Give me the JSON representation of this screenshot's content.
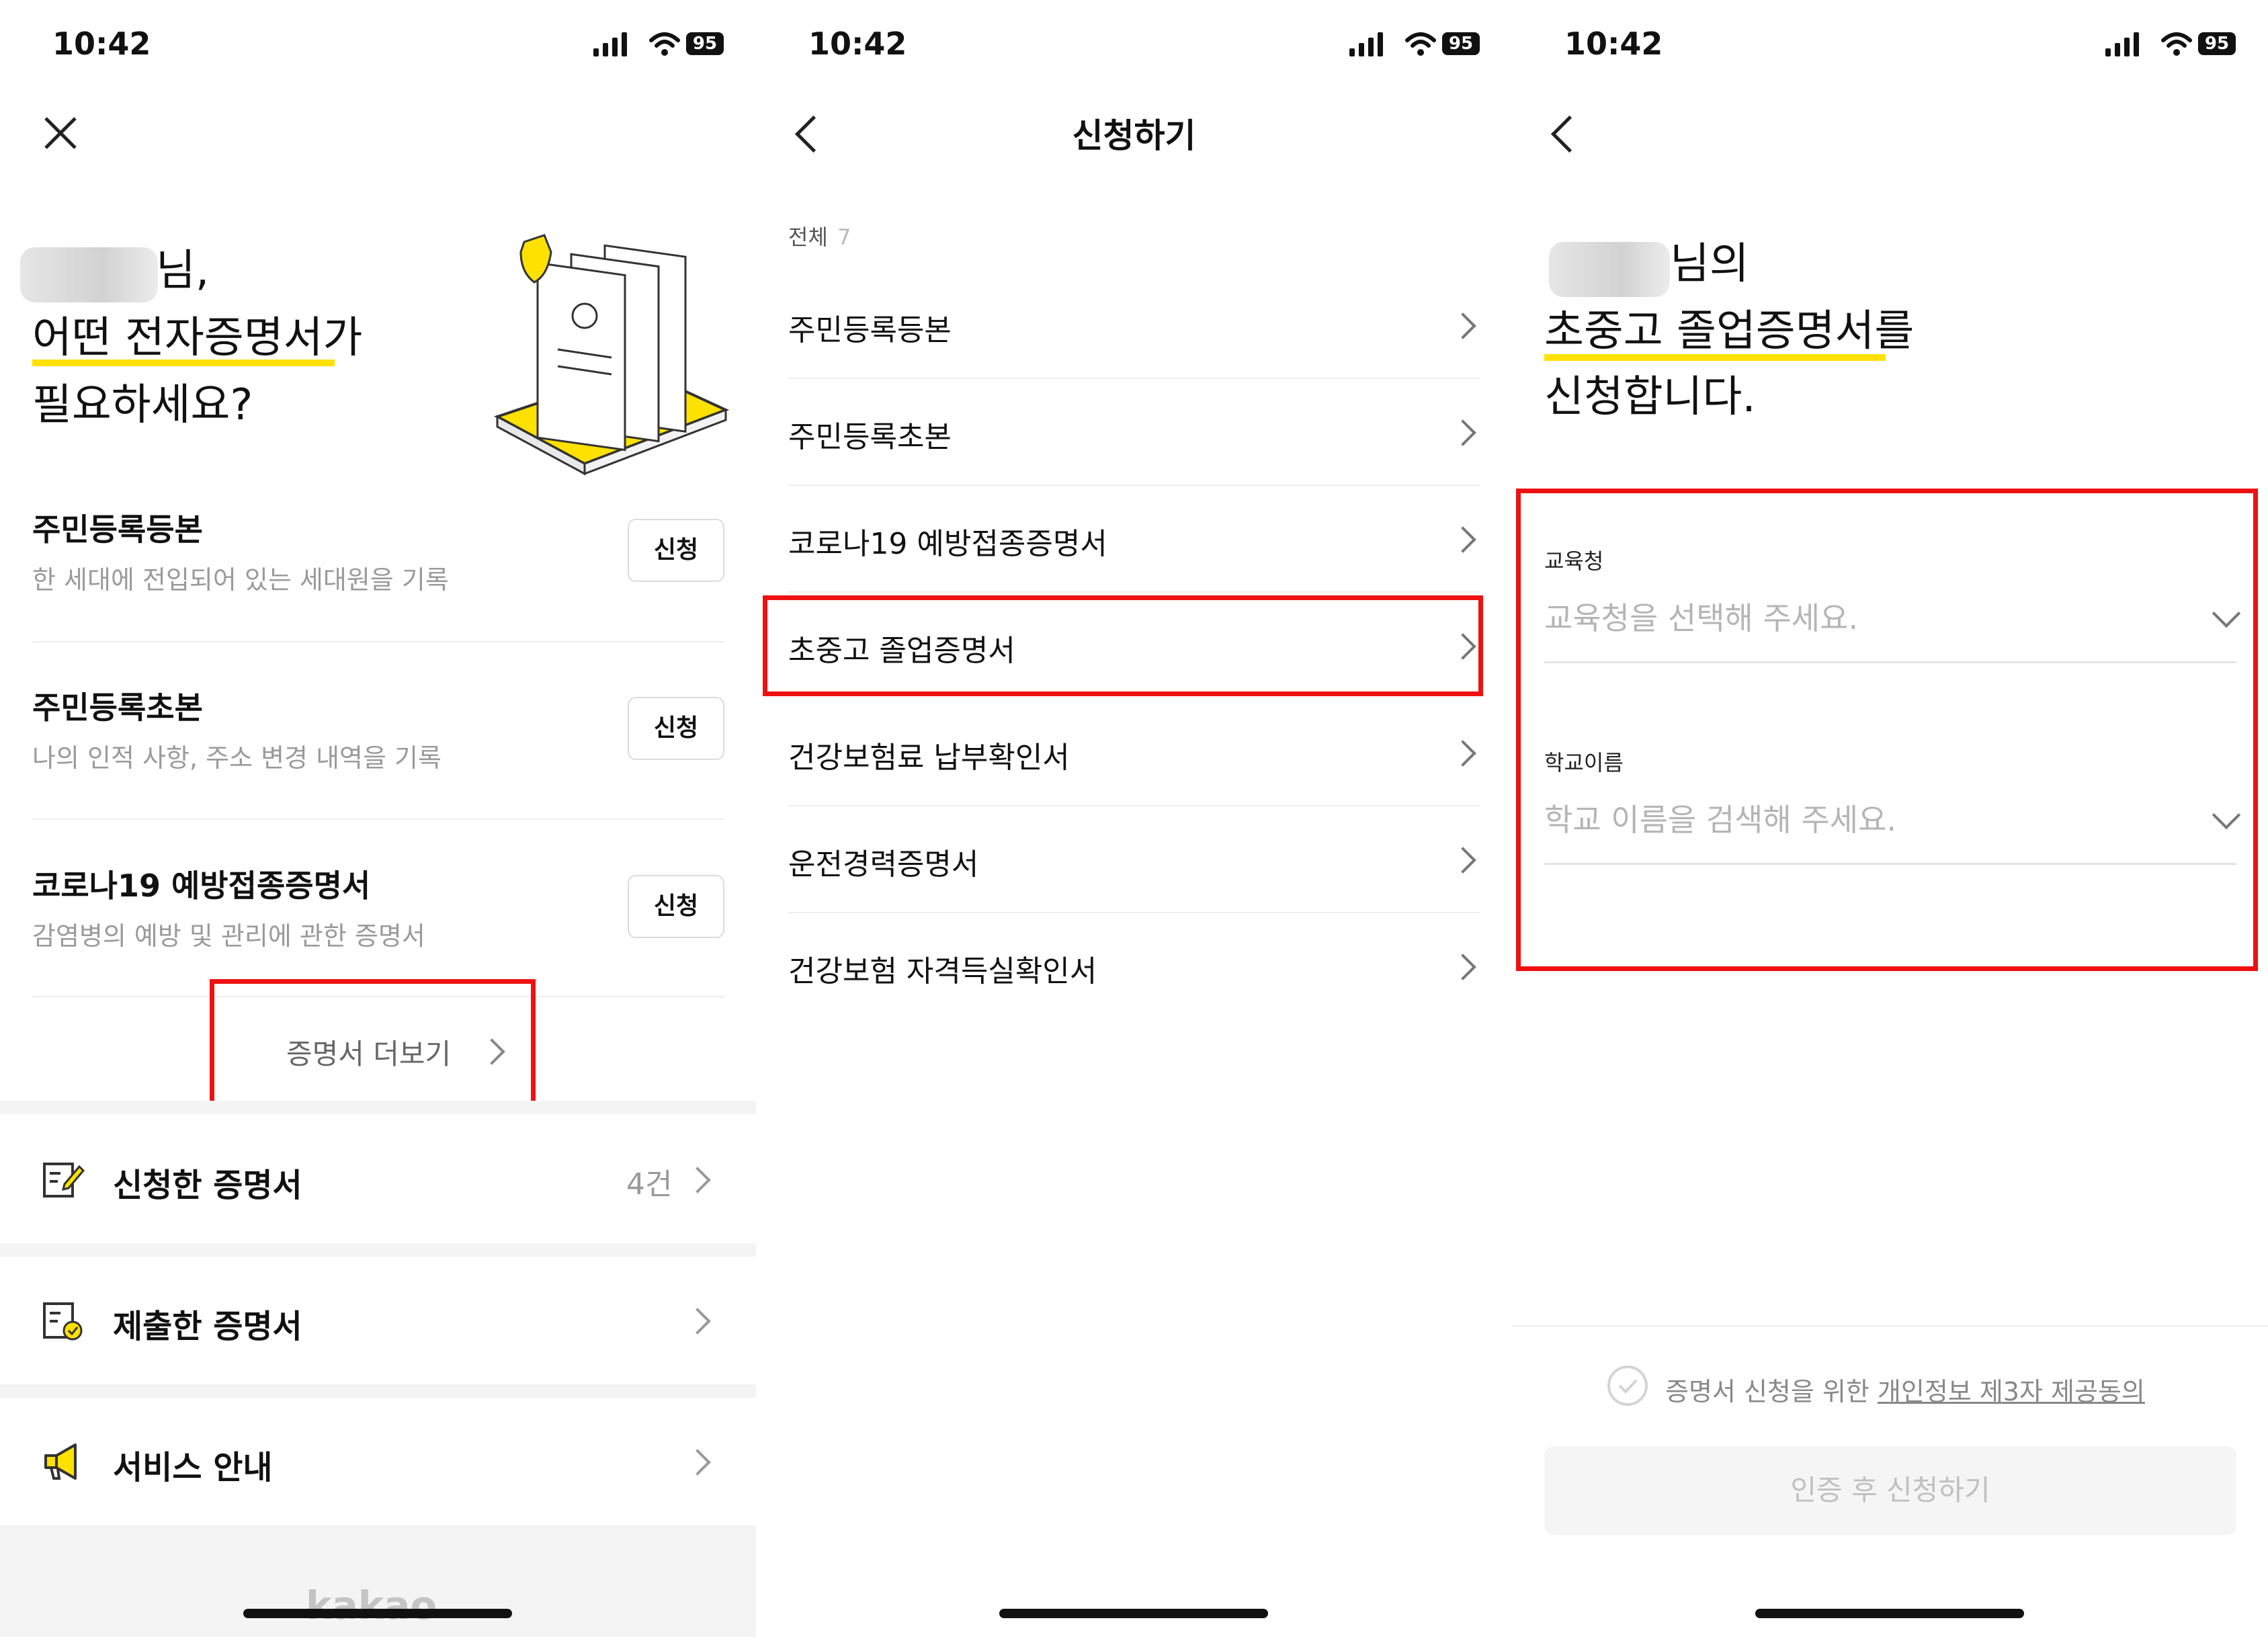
{
  "status_bar": {
    "time": "10:42",
    "battery": "95"
  },
  "home": {
    "greeting_suffix": "님,",
    "headline_line2": "어떤 전자증명서가",
    "headline_line3": "필요하세요?",
    "certs": [
      {
        "title": "주민등록등본",
        "desc": "한 세대에 전입되어 있는 세대원을 기록",
        "button": "신청"
      },
      {
        "title": "주민등록초본",
        "desc": "나의 인적 사항, 주소 변경 내역을 기록",
        "button": "신청"
      },
      {
        "title": "코로나19 예방접종증명서",
        "desc": "감염병의 예방 및 관리에 관한 증명서",
        "button": "신청"
      }
    ],
    "more_label": "증명서 더보기",
    "menu": [
      {
        "label": "신청한 증명서",
        "count": "4건",
        "icon": "edit-document-icon"
      },
      {
        "label": "제출한 증명서",
        "count": "",
        "icon": "submitted-document-icon"
      },
      {
        "label": "서비스 안내",
        "count": "",
        "icon": "megaphone-icon"
      }
    ],
    "footer_logo": "kakao"
  },
  "apply": {
    "title": "신청하기",
    "filter_label": "전체",
    "filter_count": "7",
    "items": [
      "주민등록등본",
      "주민등록초본",
      "코로나19 예방접종증명서",
      "초중고 졸업증명서",
      "건강보험료 납부확인서",
      "운전경력증명서",
      "건강보험 자격득실확인서"
    ],
    "highlighted_index": 3
  },
  "form": {
    "name_suffix": "님의",
    "cert_name": "초중고 졸업증명서를",
    "line3": "신청합니다.",
    "fields": [
      {
        "label": "교육청",
        "placeholder": "교육청을 선택해 주세요."
      },
      {
        "label": "학교이름",
        "placeholder": "학교 이름을 검색해 주세요."
      }
    ],
    "consent_prefix": "증명서 신청을 위한 ",
    "consent_link": "개인정보 제3자 제공동의",
    "submit_label": "인증 후 신청하기"
  },
  "colors": {
    "accent_yellow": "#FFE100",
    "highlight_red": "#EE1111"
  }
}
